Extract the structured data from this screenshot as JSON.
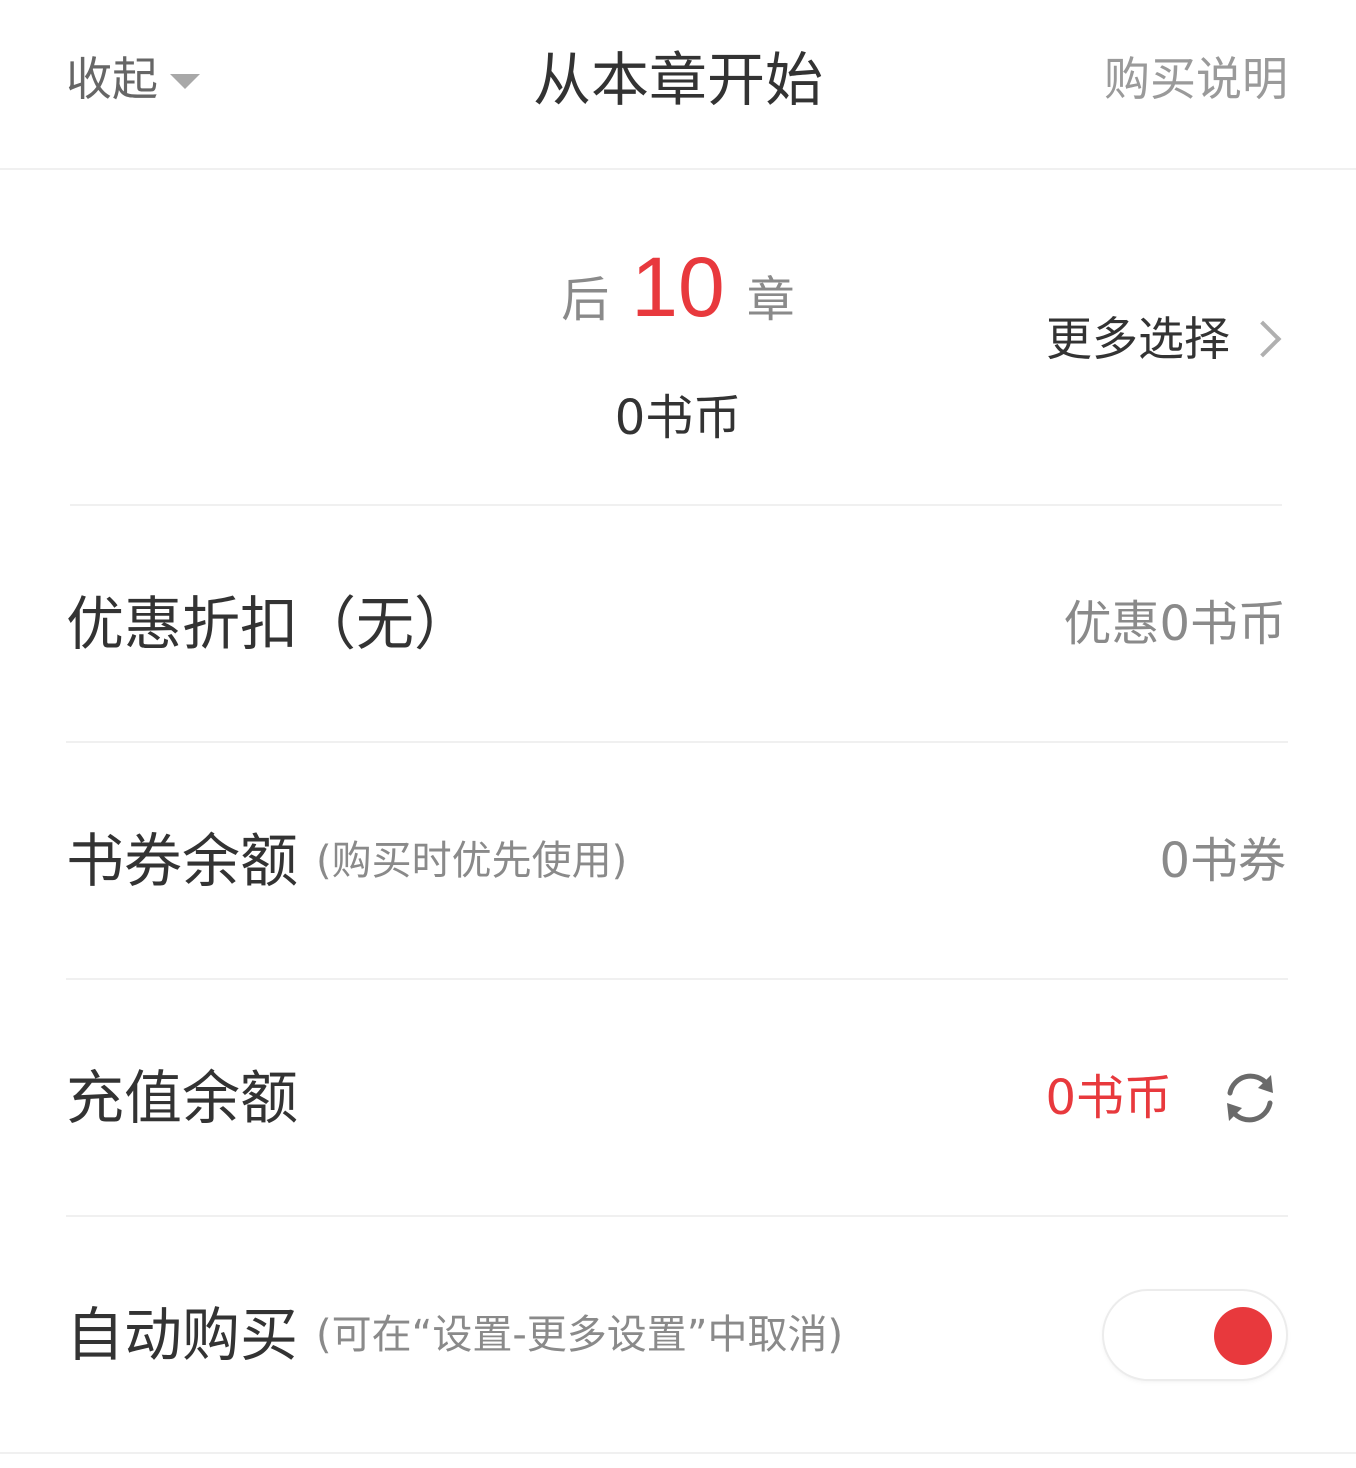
{
  "header": {
    "collapse_label": "收起",
    "title": "从本章开始",
    "help_link": "购买说明"
  },
  "chapter_selection": {
    "prefix": "后",
    "count": "10",
    "suffix": "章",
    "price": "0书币",
    "more_options": "更多选择"
  },
  "rows": {
    "discount": {
      "title": "优惠折扣（无）",
      "value": "优惠0书币"
    },
    "voucher": {
      "title": "书券余额",
      "note": "(购买时优先使用)",
      "value": "0书券"
    },
    "recharge": {
      "title": "充值余额",
      "value": "0书币"
    },
    "auto_buy": {
      "title": "自动购买",
      "note": "(可在“设置-更多设置”中取消)",
      "enabled": true
    }
  },
  "colors": {
    "accent": "#e8393d",
    "text_primary": "#333333",
    "text_secondary": "#8a8a8a",
    "divider": "#f0f0f0"
  },
  "icons": {
    "collapse": "caret-down-icon",
    "more": "chevron-right-icon",
    "refresh": "refresh-icon"
  }
}
